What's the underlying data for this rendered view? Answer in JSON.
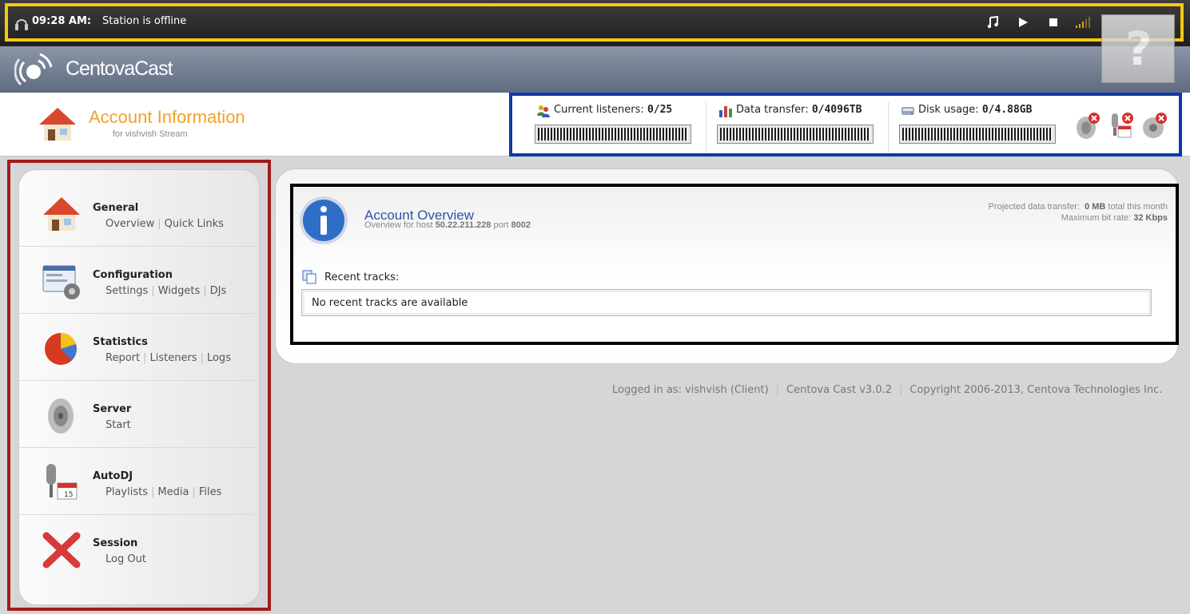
{
  "status_bar": {
    "time": "09:28 AM:",
    "message": "Station is offline",
    "controls": [
      "music-note-icon",
      "play-icon",
      "stop-icon",
      "signal-icon"
    ]
  },
  "brand": {
    "name": "CentovaCast",
    "help_glyph": "?"
  },
  "header": {
    "title": "Account Information",
    "subtitle": "for vishvish Stream"
  },
  "stats": {
    "listeners_label": "Current listeners:",
    "listeners_value": "0/25",
    "listeners_fill": 0,
    "transfer_label": "Data transfer:",
    "transfer_value": "0/4096TB",
    "transfer_fill": 0,
    "disk_label": "Disk usage:",
    "disk_value": "0/4.88GB",
    "disk_fill": 0
  },
  "sidebar": {
    "groups": [
      {
        "title": "General",
        "links": [
          "Overview",
          "Quick Links"
        ]
      },
      {
        "title": "Configuration",
        "links": [
          "Settings",
          "Widgets",
          "DJs"
        ]
      },
      {
        "title": "Statistics",
        "links": [
          "Report",
          "Listeners",
          "Logs"
        ]
      },
      {
        "title": "Server",
        "links": [
          "Start"
        ]
      },
      {
        "title": "AutoDJ",
        "links": [
          "Playlists",
          "Media",
          "Files"
        ]
      },
      {
        "title": "Session",
        "links": [
          "Log Out"
        ]
      }
    ]
  },
  "overview": {
    "title": "Account Overview",
    "sub_prefix": "Overview for host",
    "host": "50.22.211.228",
    "port_label": "port",
    "port": "8002",
    "proj_label": "Projected data transfer:",
    "proj_value": "0 MB",
    "proj_suffix": "total this month",
    "bitrate_label": "Maximum bit rate:",
    "bitrate_value": "32 Kbps",
    "recent_label": "Recent tracks:",
    "recent_empty": "No recent tracks are available"
  },
  "footer": {
    "logged_in": "Logged in as: vishvish (Client)",
    "version": "Centova Cast v3.0.2",
    "copyright": "Copyright 2006-2013, Centova Technologies Inc."
  },
  "colors": {
    "status_highlight": "#f3c813",
    "stats_highlight": "#0c3aa6",
    "sidebar_highlight": "#a01c1c",
    "overview_highlight": "#000000",
    "title_orange": "#f2a12b",
    "overview_blue": "#2a55a8"
  }
}
